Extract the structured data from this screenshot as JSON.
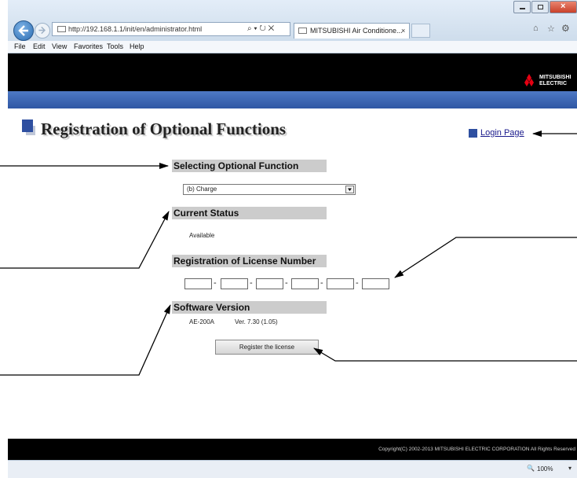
{
  "browser": {
    "address": "http://192.168.1.1/init/en/administrator.html",
    "address_controls": "⌕ ▾ ↻ ✕",
    "tab_title": "MITSUBISHI Air Conditione...",
    "menu": [
      "File",
      "Edit",
      "View",
      "Favorites",
      "Tools",
      "Help"
    ],
    "zoom": "100%"
  },
  "brand": {
    "line1": "MITSUBISHI",
    "line2": "ELECTRIC"
  },
  "page": {
    "title": "Registration of Optional Functions",
    "login_link": "Login Page",
    "sections": {
      "optional_function": "Selecting Optional Function",
      "current_status": "Current Status",
      "license": "Registration of License Number",
      "software_version": "Software Version"
    },
    "selected_function": "(b) Charge",
    "status_value": "Available",
    "license_fields": [
      "",
      "",
      "",
      "",
      "",
      ""
    ],
    "license_separator": "-",
    "model": "AE-200A",
    "version": "Ver. 7.30 (1.05)",
    "register_button": "Register the license",
    "footer": "Copyright(C) 2002-2013 MITSUBISHI ELECTRIC CORPORATION All Rights Reserved"
  },
  "colors": {
    "brand_red": "#e60012",
    "title_square": "#2e4fa0",
    "blue_bar": "#3a63ae",
    "section_bg": "#cccccc"
  }
}
